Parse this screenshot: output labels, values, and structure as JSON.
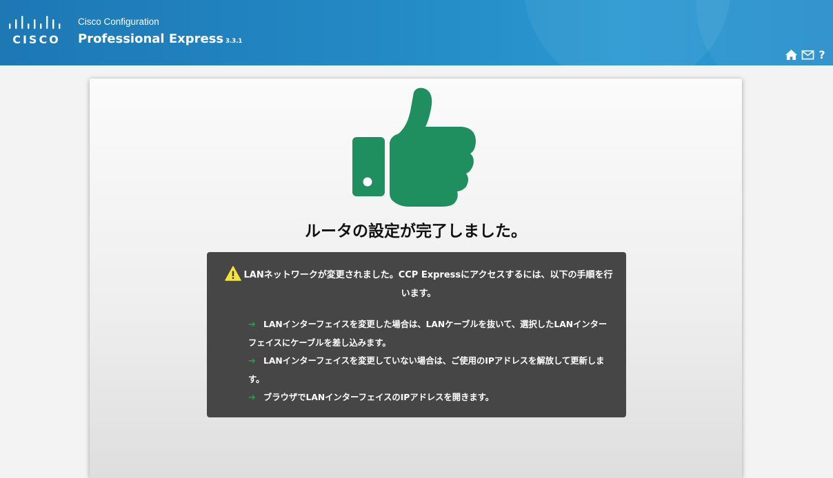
{
  "header": {
    "brand": "CISCO",
    "app_subtitle": "Cisco Configuration",
    "app_title": "Professional Express",
    "app_version": "3.3.1",
    "icons": [
      "home-icon",
      "mail-icon",
      "help-icon"
    ],
    "help_glyph": "?"
  },
  "main": {
    "success_icon": "thumbs-up-icon",
    "success_message": "ルータの設定が完了しました。",
    "notice": {
      "warning_icon": "warning-icon",
      "headline": "LANネットワークが変更されました。CCP Expressにアクセスするには、以下の手順を行います。",
      "steps": [
        "LANインターフェイスを変更した場合は、LANケーブルを抜いて、選択したLANインターフェイスにケーブルを差し込みます。",
        "LANインターフェイスを変更していない場合は、ご使用のIPアドレスを解放して更新します。",
        "ブラウザでLANインターフェイスのIPアドレスを開きます。"
      ]
    }
  },
  "colors": {
    "header_blue": "#2389c4",
    "thumb_green": "#1f8f5f",
    "notice_bg": "#464646",
    "arrow_green": "#2f9a4e",
    "warning_yellow": "#f2e43a"
  }
}
